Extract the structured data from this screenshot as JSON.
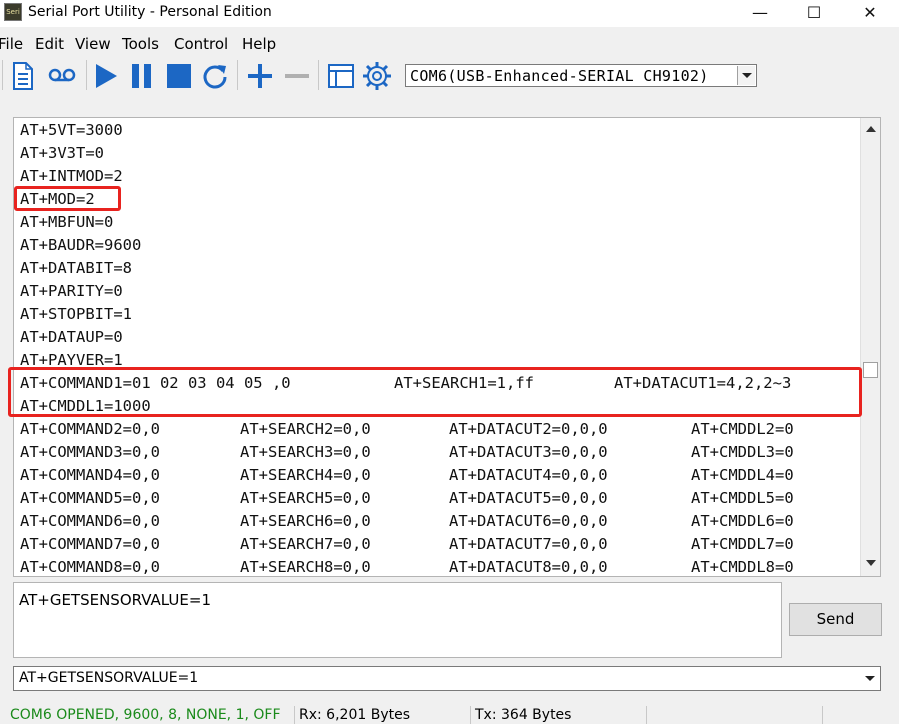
{
  "window": {
    "title": "Serial Port Utility - Personal Edition",
    "icon_text": "Seri",
    "minimize": "—",
    "maximize": "☐",
    "close": "✕"
  },
  "menu": {
    "items": [
      {
        "label": "File",
        "accel": "F"
      },
      {
        "label": "Edit",
        "accel": "E"
      },
      {
        "label": "View",
        "accel": "V"
      },
      {
        "label": "Tools",
        "accel": "T"
      },
      {
        "label": "Control",
        "accel": "C"
      },
      {
        "label": "Help",
        "accel": "H"
      }
    ]
  },
  "toolbar": {
    "icons": [
      "document-icon",
      "record-icon",
      "play-icon",
      "pause-icon",
      "stop-icon",
      "refresh-icon",
      "plus-icon",
      "minus-icon",
      "window-icon",
      "gear-icon"
    ],
    "port": "COM6(USB-Enhanced-SERIAL CH9102)"
  },
  "output": {
    "lines": [
      "AT+5VT=3000",
      "AT+3V3T=0",
      "AT+INTMOD=2",
      "AT+MOD=2",
      "AT+MBFUN=0",
      "AT+BAUDR=9600",
      "AT+DATABIT=8",
      "AT+PARITY=0",
      "AT+STOPBIT=1",
      "AT+DATAUP=0",
      "AT+PAYVER=1"
    ],
    "command1": [
      "AT+COMMAND1=01 02 03 04 05 ,0",
      "AT+SEARCH1=1,ff",
      "AT+DATACUT1=4,2,2~3"
    ],
    "cmddl1": "AT+CMDDL1=1000",
    "rows": [
      [
        "AT+COMMAND2=0,0",
        "AT+SEARCH2=0,0",
        "AT+DATACUT2=0,0,0",
        "AT+CMDDL2=0"
      ],
      [
        "AT+COMMAND3=0,0",
        "AT+SEARCH3=0,0",
        "AT+DATACUT3=0,0,0",
        "AT+CMDDL3=0"
      ],
      [
        "AT+COMMAND4=0,0",
        "AT+SEARCH4=0,0",
        "AT+DATACUT4=0,0,0",
        "AT+CMDDL4=0"
      ],
      [
        "AT+COMMAND5=0,0",
        "AT+SEARCH5=0,0",
        "AT+DATACUT5=0,0,0",
        "AT+CMDDL5=0"
      ],
      [
        "AT+COMMAND6=0,0",
        "AT+SEARCH6=0,0",
        "AT+DATACUT6=0,0,0",
        "AT+CMDDL6=0"
      ],
      [
        "AT+COMMAND7=0,0",
        "AT+SEARCH7=0,0",
        "AT+DATACUT7=0,0,0",
        "AT+CMDDL7=0"
      ],
      [
        "AT+COMMAND8=0,0",
        "AT+SEARCH8=0,0",
        "AT+DATACUT8=0,0,0",
        "AT+CMDDL8=0"
      ]
    ]
  },
  "send": {
    "text": "AT+GETSENSORVALUE=1",
    "button": "Send"
  },
  "history": {
    "value": "AT+GETSENSORVALUE=1"
  },
  "status": {
    "port_state": "COM6 OPENED, 9600, 8, NONE, 1, OFF",
    "rx": "Rx: 6,201 Bytes",
    "tx": "Tx: 364 Bytes"
  },
  "colors": {
    "highlight": "#e8231f",
    "status_ok": "#1a8a1a",
    "accent_blue": "#1c67c4"
  }
}
